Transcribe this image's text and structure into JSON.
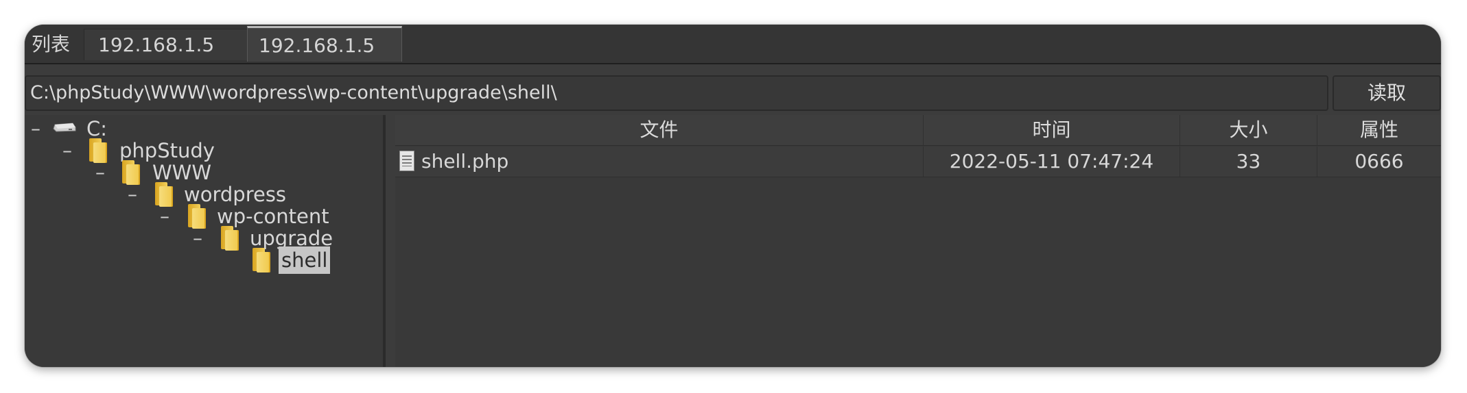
{
  "tabs": [
    {
      "label": "列表"
    },
    {
      "label": "192.168.1.5"
    },
    {
      "label": "192.168.1.5",
      "active": true
    }
  ],
  "path": {
    "value": "C:\\phpStudy\\WWW\\wordpress\\wp-content\\upgrade\\shell\\",
    "read_label": "读取"
  },
  "tree": {
    "nodes": [
      {
        "label": "C:",
        "toggle": "–",
        "icon": "drive-icon"
      },
      {
        "label": "phpStudy",
        "toggle": "–",
        "icon": "folder-icon"
      },
      {
        "label": "WWW",
        "toggle": "–",
        "icon": "folder-icon"
      },
      {
        "label": "wordpress",
        "toggle": "–",
        "icon": "folder-icon"
      },
      {
        "label": "wp-content",
        "toggle": "–",
        "icon": "folder-icon"
      },
      {
        "label": "upgrade",
        "toggle": "–",
        "icon": "folder-icon"
      },
      {
        "label": "shell",
        "toggle": "",
        "icon": "folder-icon",
        "selected": true
      }
    ]
  },
  "files": {
    "columns": [
      "文件",
      "时间",
      "大小",
      "属性"
    ],
    "rows": [
      {
        "name": "shell.php",
        "time": "2022-05-11 07:47:24",
        "size": "33",
        "attr": "0666",
        "icon": "file-icon"
      }
    ]
  },
  "colors": {
    "background": "#3c3c3c",
    "selection": "#c6c6c6",
    "folder": "#f0c84a"
  }
}
